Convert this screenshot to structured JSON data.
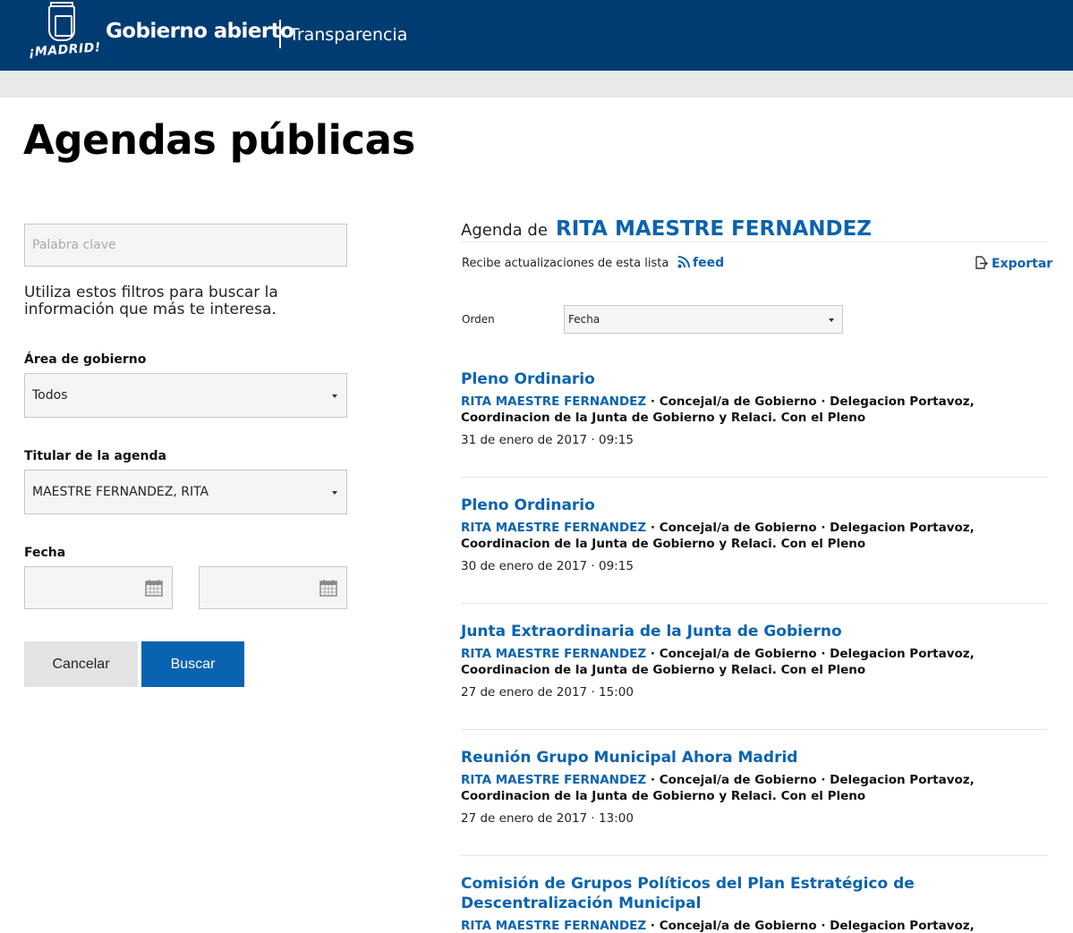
{
  "header": {
    "logo_text": "¡MADRID!",
    "brand": "Gobierno abierto",
    "section": "Transparencia"
  },
  "page_title": "Agendas públicas",
  "filters": {
    "keyword_placeholder": "Palabra clave",
    "help_text": "Utiliza estos filtros para buscar la información que más te interesa.",
    "area_label": "Área de gobierno",
    "area_value": "Todos",
    "holder_label": "Titular de la agenda",
    "holder_value": "MAESTRE FERNANDEZ, RITA",
    "date_label": "Fecha",
    "cancel_label": "Cancelar",
    "search_label": "Buscar"
  },
  "agenda": {
    "heading_prefix": "Agenda de",
    "person": "RITA MAESTRE FERNANDEZ",
    "subscribe_text": "Recibe actualizaciones de esta lista",
    "feed_label": "feed",
    "export_label": "Exportar",
    "order_label": "Orden",
    "order_value": "Fecha"
  },
  "events": [
    {
      "title": "Pleno Ordinario",
      "person": "RITA MAESTRE FERNANDEZ",
      "details": " · Concejal/a de Gobierno · Delegacion Portavoz, Coordinacion de la Junta de Gobierno y Relaci. Con el Pleno",
      "date": "31 de enero de 2017 · 09:15"
    },
    {
      "title": "Pleno Ordinario",
      "person": "RITA MAESTRE FERNANDEZ",
      "details": " · Concejal/a de Gobierno · Delegacion Portavoz, Coordinacion de la Junta de Gobierno y Relaci. Con el Pleno",
      "date": "30 de enero de 2017 · 09:15"
    },
    {
      "title": "Junta Extraordinaria de la Junta de Gobierno",
      "person": "RITA MAESTRE FERNANDEZ",
      "details": " · Concejal/a de Gobierno · Delegacion Portavoz, Coordinacion de la Junta de Gobierno y Relaci. Con el Pleno",
      "date": "27 de enero de 2017 · 15:00"
    },
    {
      "title": "Reunión Grupo Municipal Ahora Madrid",
      "person": "RITA MAESTRE FERNANDEZ",
      "details": " · Concejal/a de Gobierno · Delegacion Portavoz, Coordinacion de la Junta de Gobierno y Relaci. Con el Pleno",
      "date": "27 de enero de 2017 · 13:00"
    },
    {
      "title": "Comisión de Grupos Políticos del Plan Estratégico de Descentralización Municipal",
      "person": "RITA MAESTRE FERNANDEZ",
      "details": " · Concejal/a de Gobierno · Delegacion Portavoz, Coordinacion de la",
      "date": ""
    }
  ]
}
